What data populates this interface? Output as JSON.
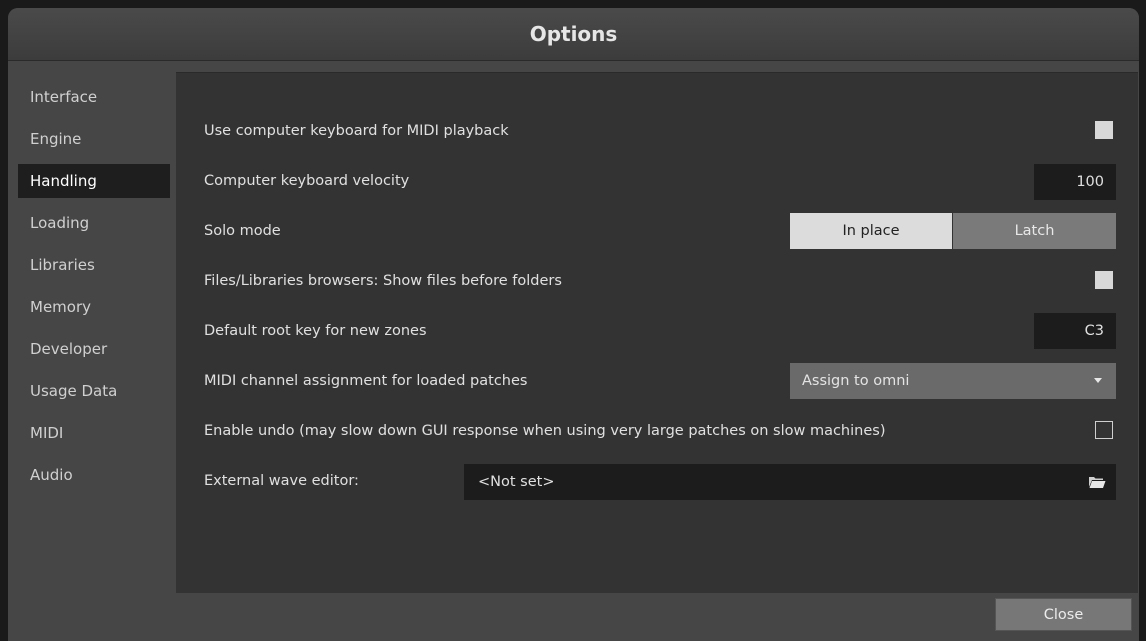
{
  "window": {
    "title": "Options"
  },
  "sidebar": {
    "items": [
      {
        "label": "Interface"
      },
      {
        "label": "Engine"
      },
      {
        "label": "Handling",
        "active": true
      },
      {
        "label": "Loading"
      },
      {
        "label": "Libraries"
      },
      {
        "label": "Memory"
      },
      {
        "label": "Developer"
      },
      {
        "label": "Usage Data"
      },
      {
        "label": "MIDI"
      },
      {
        "label": "Audio"
      }
    ]
  },
  "settings": {
    "midi_playback": {
      "label": "Use computer keyboard for MIDI playback",
      "checked": true
    },
    "velocity": {
      "label": "Computer keyboard velocity",
      "value": "100"
    },
    "solo_mode": {
      "label": "Solo mode",
      "options": [
        "In place",
        "Latch"
      ],
      "selected": "In place"
    },
    "files_first": {
      "label": "Files/Libraries browsers: Show files before folders",
      "checked": true
    },
    "root_key": {
      "label": "Default root key for new zones",
      "value": "C3"
    },
    "midi_channel": {
      "label": "MIDI channel assignment for loaded patches",
      "value": "Assign to omni"
    },
    "undo": {
      "label": "Enable undo (may slow down GUI response when using very large patches on slow machines)",
      "checked": false
    },
    "wave_editor": {
      "label": "External wave editor:",
      "value": "<Not set>"
    }
  },
  "footer": {
    "close_label": "Close"
  },
  "icons": {
    "folder": "folder-icon",
    "dropdown": "chevron-down-icon"
  }
}
